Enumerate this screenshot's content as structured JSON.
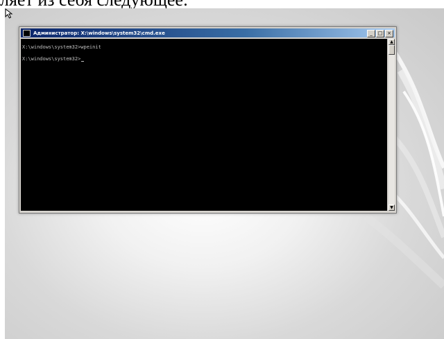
{
  "caption": {
    "text": "ляет из себя следующее:"
  },
  "window": {
    "title": "Администратор: X:\\windows\\system32\\cmd.exe",
    "controls": {
      "minimize": "_",
      "maximize": "□",
      "close": "×"
    }
  },
  "console": {
    "lines": [
      "X:\\windows\\system32>wpeinit",
      "X:\\windows\\system32>"
    ]
  },
  "scrollbar": {
    "up_arrow": "▲",
    "down_arrow": "▼"
  }
}
